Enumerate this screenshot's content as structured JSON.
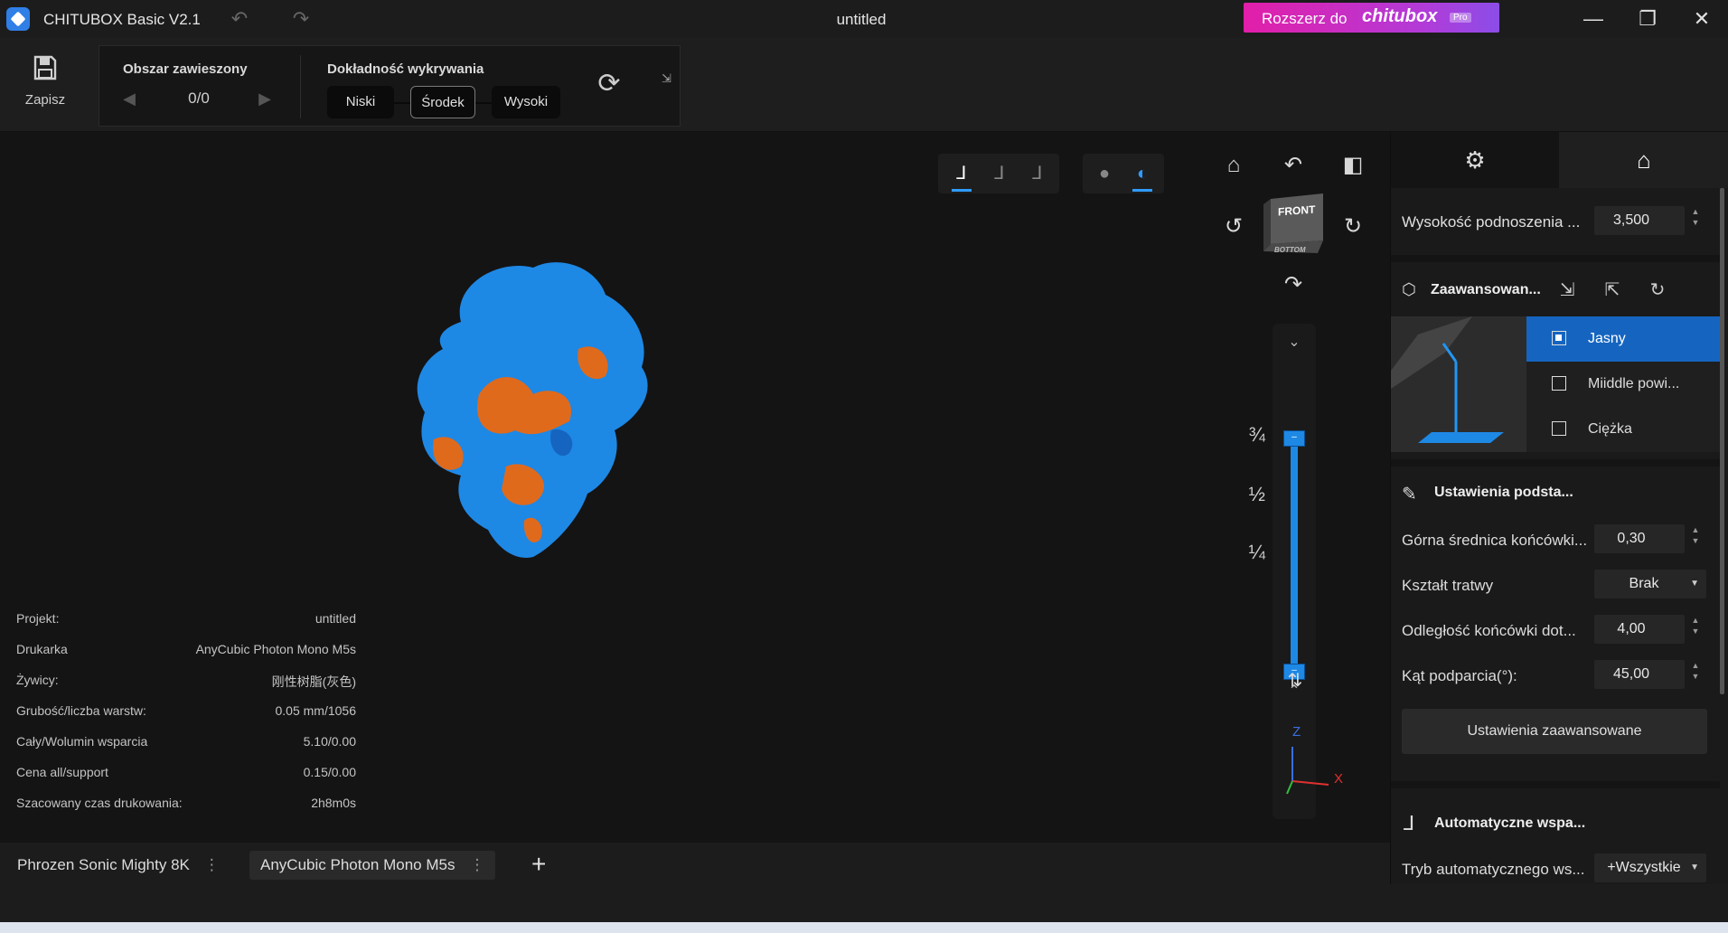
{
  "app": {
    "title": "CHITUBOX Basic V2.1",
    "document": "untitled"
  },
  "upgrade": {
    "label": "Rozszerz do",
    "brand": "chitubox",
    "badge": "Pro"
  },
  "toolbar": {
    "save_label": "Zapisz"
  },
  "detection": {
    "overhang_title": "Obszar zawieszony",
    "overhang_count": "0/0",
    "accuracy_title": "Dokładność wykrywania",
    "accuracy_options": [
      "Niski",
      "Środek",
      "Wysoki"
    ],
    "accuracy_selected": "Środek"
  },
  "viewcube": {
    "front": "FRONT",
    "bottom": "BOTTOM"
  },
  "slider": {
    "marks": [
      "¾",
      "½",
      "¼"
    ],
    "handle_top": "–",
    "handle_bottom": "–"
  },
  "axes": {
    "z": "Z",
    "x": "X"
  },
  "info": [
    {
      "key": "Projekt:",
      "value": "untitled"
    },
    {
      "key": "Drukarka",
      "value": "AnyCubic Photon Mono M5s"
    },
    {
      "key": "Żywicy:",
      "value": "刚性树脂(灰色)"
    },
    {
      "key": "Grubość/liczba warstw:",
      "value": "0.05 mm/1056"
    },
    {
      "key": "Cały/Wolumin wsparcia",
      "value": "5.10/0.00"
    },
    {
      "key": "Cena all/support",
      "value": "0.15/0.00"
    },
    {
      "key": "Szacowany czas drukowania:",
      "value": "2h8m0s"
    }
  ],
  "panel": {
    "lift_height": {
      "label": "Wysokość podnoszenia ...",
      "value": "3,500"
    },
    "advanced": {
      "title": "Zaawansowan...",
      "presets": [
        "Jasny",
        "Miiddle powi...",
        "Ciężka"
      ],
      "selected": "Jasny"
    },
    "basic": {
      "title": "Ustawienia podsta...",
      "rows": [
        {
          "label": "Górna średnica końcówki...",
          "value": "0,30"
        },
        {
          "label": "Kształt tratwy",
          "value": "Brak"
        },
        {
          "label": "Odległość końcówki dot...",
          "value": "4,00"
        },
        {
          "label": "Kąt podparcia(°):",
          "value": "45,00"
        }
      ]
    },
    "advanced_button": "Ustawienia zaawansowane",
    "auto": {
      "title": "Automatyczne wspa...",
      "mode_label": "Tryb automatycznego ws...",
      "mode_value": "+Wszystkie"
    }
  },
  "printers": {
    "tabs": [
      "Phrozen Sonic Mighty 8K",
      "AnyCubic Photon Mono M5s"
    ],
    "active": "AnyCubic Photon Mono M5s",
    "add": "+"
  },
  "colors": {
    "accent": "#1e88e5",
    "model_primary": "#1e88e5",
    "model_overhang": "#e06a1c",
    "upgrade_start": "#e21ea9",
    "upgrade_end": "#8c4de8"
  }
}
